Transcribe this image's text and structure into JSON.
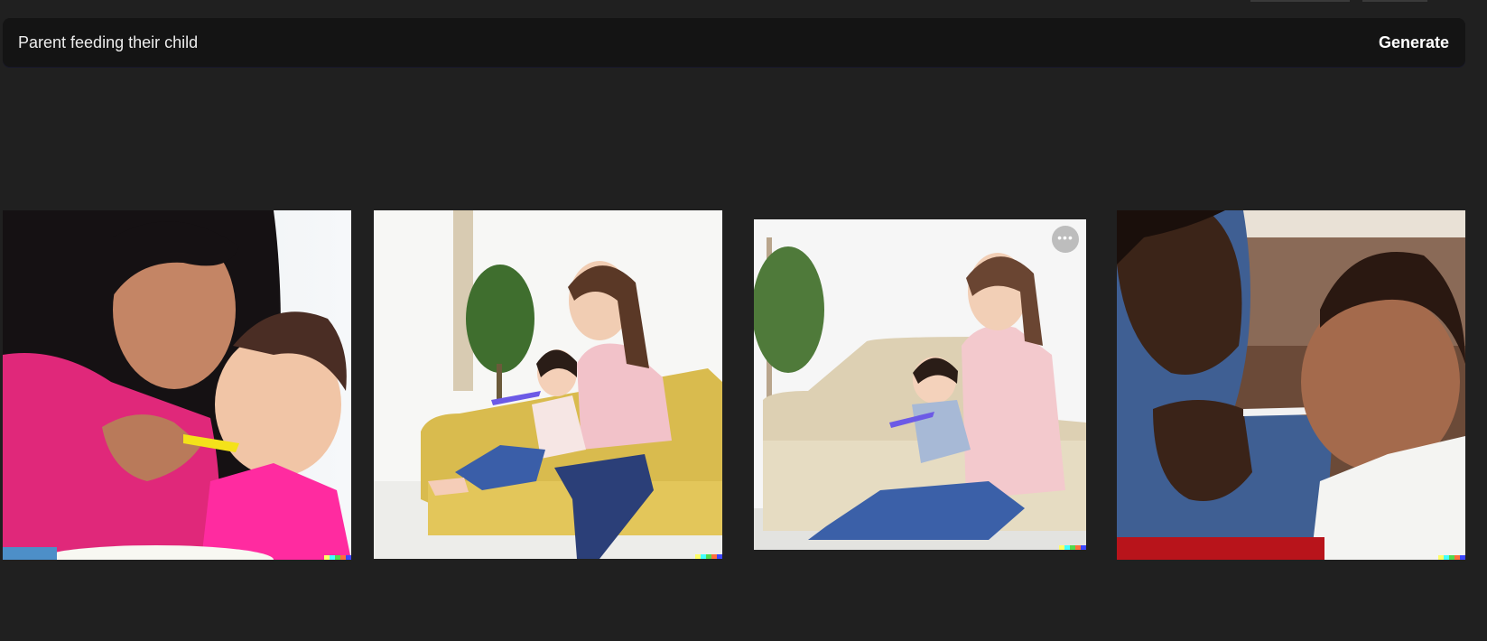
{
  "prompt": {
    "text": "Parent feeding their child"
  },
  "actions": {
    "generate_label": "Generate"
  },
  "results": [
    {
      "more_icon_glyph": "•••"
    },
    {
      "more_icon_glyph": "•••"
    },
    {
      "more_icon_glyph": "•••"
    },
    {
      "more_icon_glyph": "•••"
    }
  ],
  "colors": {
    "background": "#202020",
    "prompt_bar": "#141414",
    "signature": [
      "#ffff66",
      "#42ffff",
      "#51da4c",
      "#ff6e3c",
      "#3c46ff"
    ]
  }
}
